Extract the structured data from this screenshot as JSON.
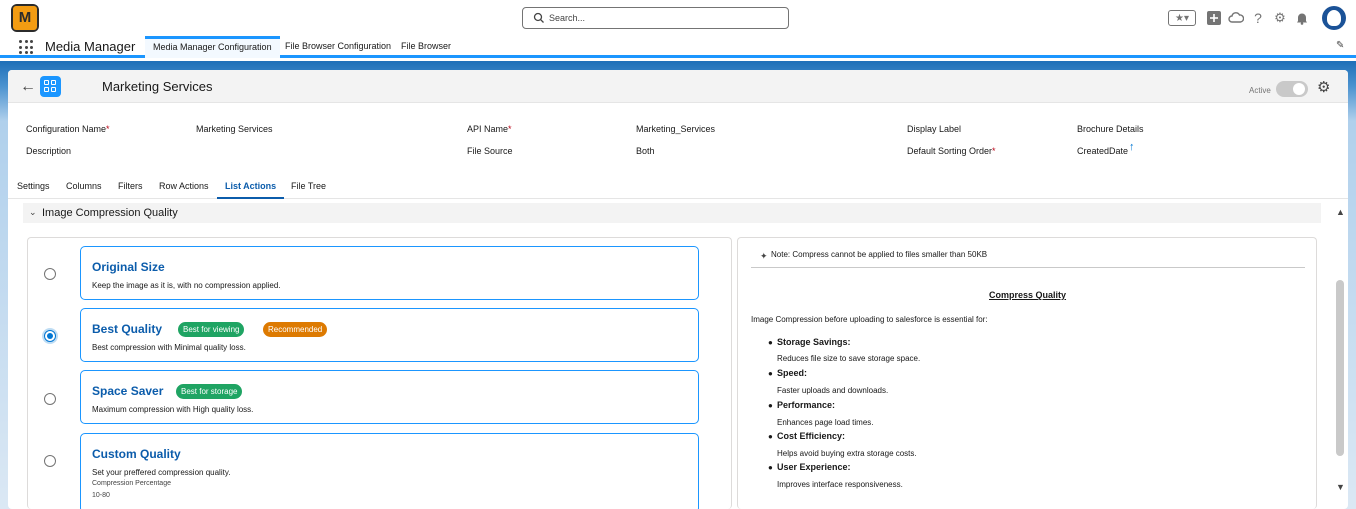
{
  "header": {
    "logo_text": "M",
    "search_placeholder": "Search..."
  },
  "icons": {
    "favorites": "star-icon",
    "add": "plus-icon",
    "trailhead": "cloud-icon",
    "help": "question-icon",
    "setup": "gear-icon",
    "notifications": "bell-icon",
    "avatar": "avatar-icon"
  },
  "appnav": {
    "app_name": "Media Manager",
    "tabs": [
      {
        "label": "Media Manager Configuration",
        "active": true
      },
      {
        "label": "File Browser Configuration",
        "active": false
      },
      {
        "label": "File Browser",
        "active": false
      }
    ]
  },
  "record": {
    "title": "Marketing Services",
    "active_label": "Active"
  },
  "fields": {
    "config_name_label": "Configuration Name",
    "config_name_value": "Marketing Services",
    "api_name_label": "API Name",
    "api_name_value": "Marketing_Services",
    "display_label_label": "Display Label",
    "display_label_value": "Brochure Details",
    "description_label": "Description",
    "file_source_label": "File Source",
    "file_source_value": "Both",
    "sorting_label": "Default Sorting Order",
    "sorting_value": "CreatedDate",
    "required_marker": "*"
  },
  "tabs": [
    {
      "label": "Settings",
      "active": false
    },
    {
      "label": "Columns",
      "active": false
    },
    {
      "label": "Filters",
      "active": false
    },
    {
      "label": "Row Actions",
      "active": false
    },
    {
      "label": "List Actions",
      "active": true
    },
    {
      "label": "File Tree",
      "active": false
    }
  ],
  "section": {
    "title": "Image Compression Quality"
  },
  "options": [
    {
      "title": "Original Size",
      "desc": "Keep the image as it is, with no compression applied.",
      "selected": false
    },
    {
      "title": "Best Quality",
      "desc": "Best compression with Minimal quality loss.",
      "selected": true,
      "badges": [
        "Best for viewing",
        "Recommended"
      ]
    },
    {
      "title": "Space Saver",
      "desc": "Maximum compression with High quality loss.",
      "selected": false,
      "badges": [
        "Best for storage"
      ]
    },
    {
      "title": "Custom Quality",
      "desc": "Set your preffered compression quality.",
      "selected": false,
      "extra_label": "Compression Percentage",
      "extra_range": "10-80"
    }
  ],
  "info": {
    "note": "Note: Compress cannot be applied to files smaller than 50KB",
    "title": "Compress Quality",
    "intro": "Image Compression before uploading to salesforce is essential for:",
    "bullets": [
      {
        "head": "Storage Savings:",
        "desc": "Reduces file size to save storage space."
      },
      {
        "head": "Speed:",
        "desc": "Faster uploads and downloads."
      },
      {
        "head": "Performance:",
        "desc": "Enhances page load times."
      },
      {
        "head": "Cost Efficiency:",
        "desc": "Helps avoid buying extra storage costs."
      },
      {
        "head": "User Experience:",
        "desc": "Improves interface responsiveness."
      }
    ]
  },
  "colors": {
    "brand_blue": "#1b96ff",
    "link_blue": "#0b5cab",
    "badge_green": "#1fa463",
    "badge_orange": "#dd7a01",
    "logo_orange": "#f39c12"
  }
}
